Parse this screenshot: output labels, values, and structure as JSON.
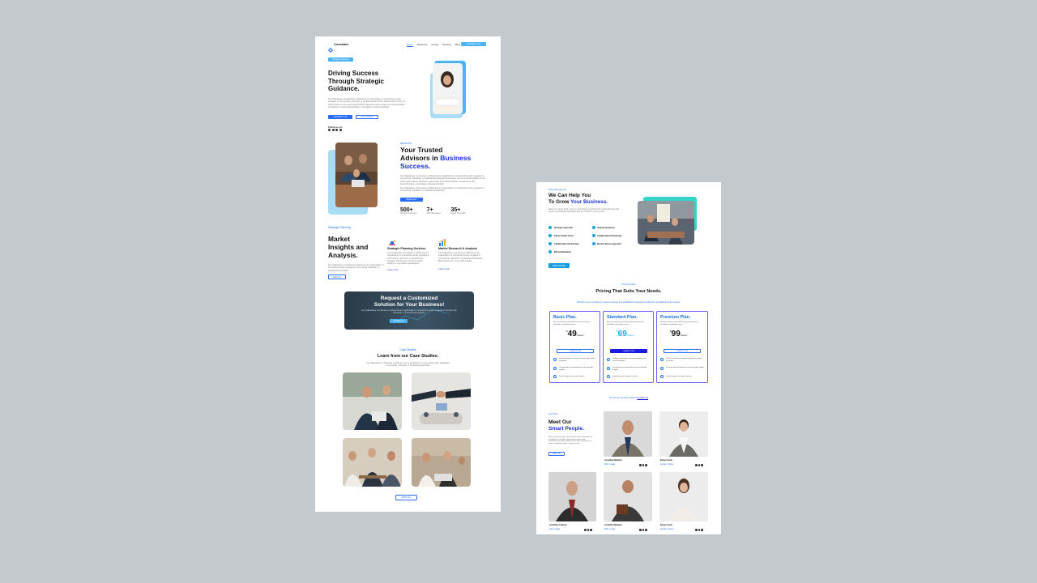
{
  "landing": {
    "brand": "Consultant",
    "nav": [
      "Home",
      "Whatsnew",
      "Pricing",
      "Services",
      "Blog"
    ],
    "nav_cta": "CONTACT US",
    "hero": {
      "badge": "Strategic Advisors",
      "title_line1": "Driving Success",
      "title_line2": "Through Strategic",
      "title_line3": "Guidance.",
      "desc": "Key Takeaways: A business is defined as an organization or enterprising entity engaged in commercial, industrial, or professional activities. Businesses can be for-profit entities or non-profit organizations. Business types range from limited liability companies to sole proprietorships, corporations, and partnerships.",
      "cta_primary": "CONTACT US",
      "cta_secondary": "Free Consult",
      "follow": "Follow us on:"
    },
    "about": {
      "label": "About Us",
      "title_line1": "Your Trusted",
      "title_line2": "Advisors in",
      "title_highlight1": "Business",
      "title_highlight2": "Success.",
      "p1": "Key Takeaways: A business is defined as an organization or enterprising entity engaged in commercial, industrial, or professional activities. Businesses can be for-profit entities or non-profit organizations. Business types range from limited liability companies to sole proprietorships, corporations, and partnerships.",
      "p2": "Key Takeaways: A business is defined as an organization or enterprising entity engaged in commercial, industrial, or professional activities.",
      "cta": "Read more",
      "stats": [
        {
          "value": "500+",
          "label": "Satisfied Customers"
        },
        {
          "value": "7+",
          "label": "Years Experience"
        },
        {
          "value": "35+",
          "label": "Expert Consultant"
        }
      ]
    },
    "insights": {
      "label": "Strategic Planning",
      "title_line1": "Market",
      "title_line2": "Insights and",
      "title_line3": "Analysis.",
      "desc": "Key Takeaways: A business is defined as an organization or enterprising entity engaged in commercial, industrial, or professional activities.",
      "cta": "VIEW ALL",
      "services": [
        {
          "title": "Strategic Planning Services",
          "desc": "Key Takeaways: A business is defined as an organization or enterprising entity engaged in commercial, industrial, or professional activities. Businesses can be for-profit entities or non-profit organizations.",
          "link": "Learn more"
        },
        {
          "title": "Market Research & Analysis",
          "desc": "Key Takeaways: A business is defined as an organization or enterprising entity engaged in commercial, industrial, or professional activities. Businesses can be for-profit entities.",
          "link": "Learn more"
        }
      ]
    },
    "banner": {
      "title_line1": "Request a Customized",
      "title_line2": "Solution for Your Business!",
      "desc": "Key Takeaways: A business is defined as an organization or enterprising entity engaged in commercial, industrial, or professional activities.",
      "cta": "Contact Us"
    },
    "cases": {
      "label": "Case Studies",
      "title": "Learn from our Case Studies.",
      "desc": "Key Takeaways: A business is defined as an organization or enterprising entity engaged in commercial, industrial, or professional activities.",
      "cta": "VIEW ALL"
    }
  },
  "second": {
    "why": {
      "label": "Why Choose Us",
      "title_line1": "We Can Help You",
      "title_line2": "To Grow",
      "title_highlight": "Your Business.",
      "desc": "Takes on a career break, you're on your living at everything the means partnering with a team of dedicated professionals who are invested in your success.",
      "features": [
        "Strategic Approach",
        "Industry Expertise",
        "Client-Centric Focus",
        "Collaborative Partnership",
        "Collaborative Partnership",
        "Results-Driven Approach",
        "Ethical Standards"
      ],
      "cta": "READ MORE"
    },
    "pricing": {
      "label": "Pricing Plans",
      "title": "Pricing That Suits Your Needs.",
      "subtitle": "Whether you're a startup or a large company in a established corporation looking for specialized expert support.",
      "plans": [
        {
          "name": "Basic Plan.",
          "desc": "Ideal for startups and small businesses looking for affordable consulting services.",
          "currency": "$",
          "price": "49",
          "period": "/Session",
          "cta": "LEARN MORE",
          "features": [
            "Initial consultation session to assess your needs and goals",
            "Customized recommendations and actionable insights",
            "Limited support via email or phone"
          ]
        },
        {
          "name": "Standard Plan.",
          "desc": "Ideal for startups and small businesses looking for affordable consulting services.",
          "currency": "$",
          "price": "69",
          "period": "/Session",
          "cta": "LEARN MORE",
          "features": [
            "In-depth consultation session to address your needs and goals",
            "Customized recommendations and actionable insights",
            "Limited support via email or phone"
          ]
        },
        {
          "name": "Premium Plan.",
          "desc": "Ideal for startups and small businesses looking for affordable consulting services.",
          "currency": "$",
          "price": "99",
          "period": "/Session",
          "cta": "LEARN MORE",
          "features": [
            "Initial consultation session to assess your needs and goals",
            "Customized personalization and actionable insights",
            "Limited support via email or phone"
          ]
        }
      ],
      "footer": "Is such as our three plans?",
      "footer_link": "Contact Us"
    },
    "team": {
      "label": "Our Team",
      "title_line1": "Meet Our",
      "title_highlight": "Smart People.",
      "desc": "We're a diverse range of excellence and commitment to excellence, our team is dedicated to delivering innovative consulting solutions that drive result. We're a team of talented experts at your service.",
      "cta": "VIEW ALL",
      "members": [
        {
          "name": "Jonathan Matiwer",
          "role": "CEO, Leader"
        },
        {
          "name": "Baeyn Huch",
          "role": "Jobsper, Scriver"
        },
        {
          "name": "Jonathan Andrew",
          "role": "CEO, Leader"
        },
        {
          "name": "Jonathan Matiwer",
          "role": "CEO, Leader"
        },
        {
          "name": "Baeyn Huch",
          "role": "Jobsper, Scriver"
        }
      ]
    }
  }
}
